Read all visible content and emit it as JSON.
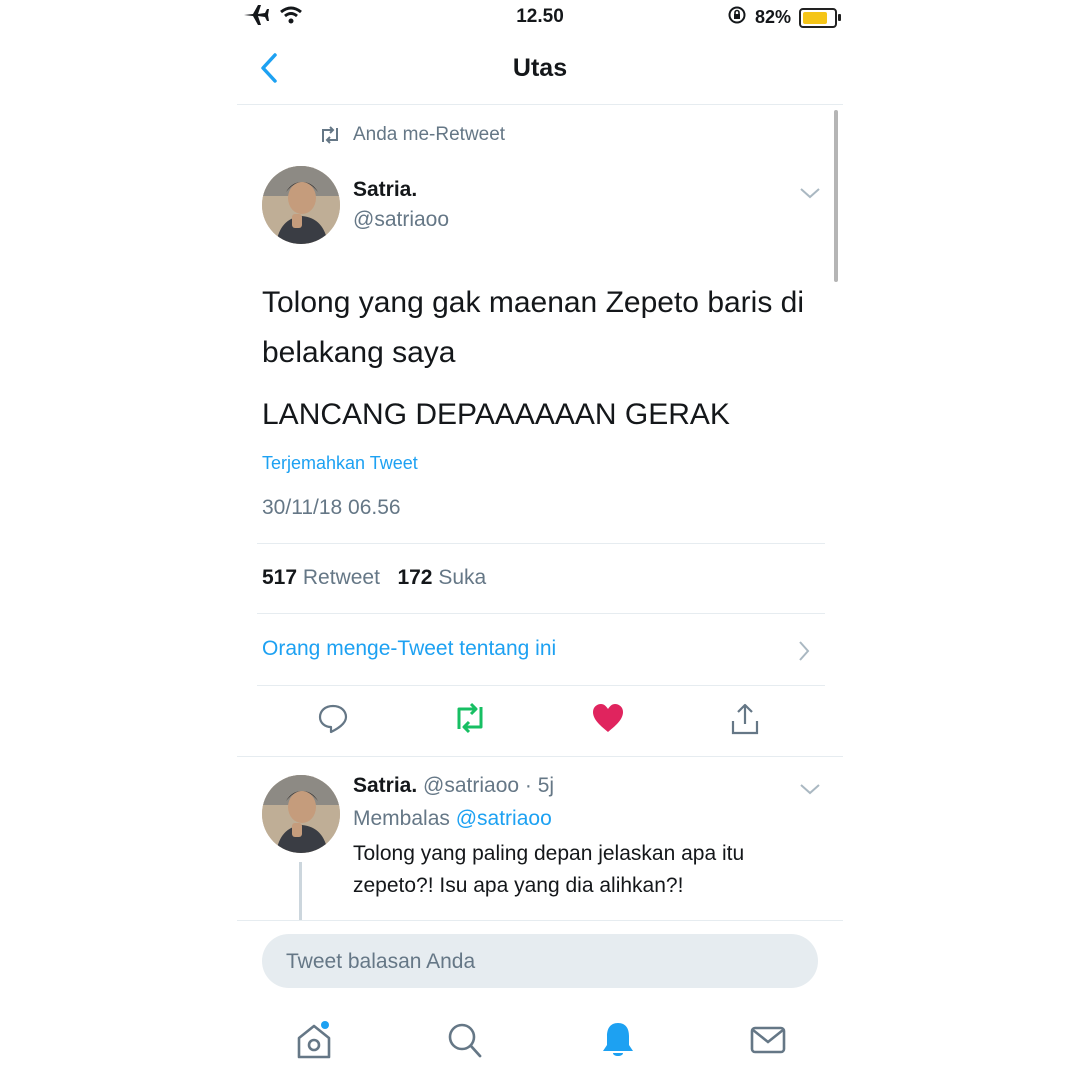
{
  "status_bar": {
    "time": "12.50",
    "battery_percent": "82%",
    "battery_level": 0.82,
    "icons": [
      "airplane-icon",
      "wifi-icon",
      "rotation-lock-icon",
      "battery-icon"
    ]
  },
  "header": {
    "title": "Utas",
    "back_icon": "chevron-left-icon"
  },
  "main_tweet": {
    "retweet_context": "Anda me-Retweet",
    "author_name": "Satria.",
    "author_handle": "@satriaoo",
    "text_line1": "Tolong yang gak maenan Zepeto baris di belakang saya",
    "text_line2": "LANCANG DEPAAAAAAN GERAK",
    "translate_label": "Terjemahkan Tweet",
    "timestamp": "30/11/18 06.56",
    "retweet_count": "517",
    "retweet_label": "Retweet",
    "like_count": "172",
    "like_label": "Suka",
    "quotes_link": "Orang menge-Tweet tentang ini",
    "retweeted": true,
    "liked": true
  },
  "reply_tweet": {
    "author_name": "Satria.",
    "author_handle": "@satriaoo",
    "time_ago": "· 5j",
    "replying_prefix": "Membalas",
    "replying_to": "@satriaoo",
    "text": "Tolong yang paling depan jelaskan apa itu zepeto?! Isu apa yang dia alihkan?!"
  },
  "composer": {
    "placeholder": "Tweet balasan Anda"
  },
  "tab_bar": {
    "tabs": [
      "home-icon",
      "search-icon",
      "notifications-icon",
      "messages-icon"
    ],
    "active": "notifications-icon"
  },
  "colors": {
    "accent": "#1da1f2",
    "retweet_green": "#17bf63",
    "like_red": "#e0245e",
    "muted": "#657786",
    "battery_yellow": "#f5c518"
  }
}
